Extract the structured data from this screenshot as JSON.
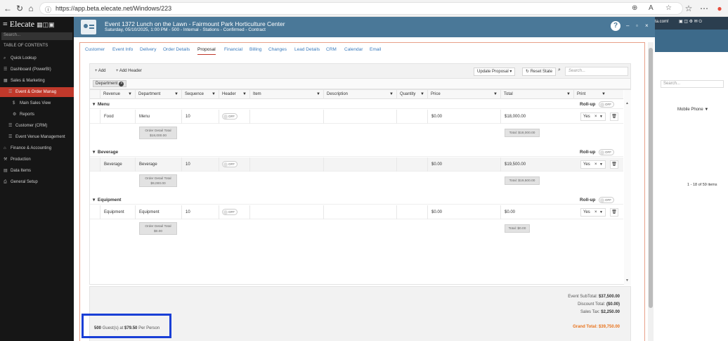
{
  "browser": {
    "url": "https://app.beta.elecate.net/Windows/223"
  },
  "app": {
    "brand": "Elecate",
    "search_placeholder": "Search...",
    "toc": "TABLE OF CONTENTS",
    "nav": [
      "Quick Lookup",
      "Dashboard (PowerBI)",
      "Sales & Marketing",
      "Event & Order Manag",
      "Main Sales View",
      "Reports",
      "Customer (CRM)",
      "Event Venue Management",
      "Finance & Accounting",
      "Production",
      "Data Items",
      "General Setup"
    ]
  },
  "background": {
    "header_text": "ta.com!",
    "search": "Search...",
    "col": "Mobile Phone",
    "paging": "1 - 18 of 59 items"
  },
  "modal": {
    "title": "Event 1372 Lunch on the Lawn - Fairmount Park Horticulture Center",
    "subtitle": "Saturday, 05/10/2025, 1:00 PM - 500 - Internal - Stations - Confirmed - Contract",
    "tabs": [
      "Customer",
      "Event Info",
      "Delivery",
      "Order Details",
      "Proposal",
      "Financial",
      "Billing",
      "Changes",
      "Lead Details",
      "CRM",
      "Calendar",
      "Email"
    ],
    "toolbar": {
      "add": "+ Add",
      "add_header": "+ Add Header",
      "update": "Update Proposal",
      "reset": "Reset State",
      "search_placeholder": "Search..."
    },
    "group_chip": "Department",
    "columns": [
      "Revenue",
      "Department",
      "Sequence",
      "Header",
      "Item",
      "Description",
      "Quantity",
      "Price",
      "Total",
      "Print"
    ],
    "rollup": "Roll-up",
    "off": "OFF",
    "groups": [
      {
        "name": "Menu",
        "revenue": "Food",
        "department": "Menu",
        "sequence": "10",
        "price": "$0.00",
        "total": "$18,000.00",
        "print": "Yes",
        "footer_label": "Order Detail Total",
        "footer_value": "$18,000.00",
        "total_label": "Total: $18,000.00"
      },
      {
        "name": "Beverage",
        "revenue": "Beverage",
        "department": "Beverage",
        "sequence": "10",
        "price": "$0.00",
        "total": "$19,500.00",
        "print": "Yes",
        "footer_label": "Order Detail Total",
        "footer_value": "$9,000.00",
        "total_label": "Total: $19,500.00"
      },
      {
        "name": "Equipment",
        "revenue": "Equipment",
        "department": "Equipment",
        "sequence": "10",
        "price": "$0.00",
        "total": "$0.00",
        "print": "Yes",
        "footer_label": "Order Detail Total",
        "footer_value": "$0.00",
        "total_label": "Total: $0.00"
      }
    ],
    "totals": {
      "subtotal_label": "Event SubTotal:",
      "subtotal": "$37,500.00",
      "discount_label": "Discount Total:",
      "discount": "($0.00)",
      "tax_label": "Sales Tax:",
      "tax": "$2,250.00",
      "grand_label": "Grand Total:",
      "grand": "$39,750.00"
    },
    "guests": {
      "count": "500",
      "text": "Guest(s) at",
      "rate": "$79.50",
      "per": "Per Person"
    }
  }
}
